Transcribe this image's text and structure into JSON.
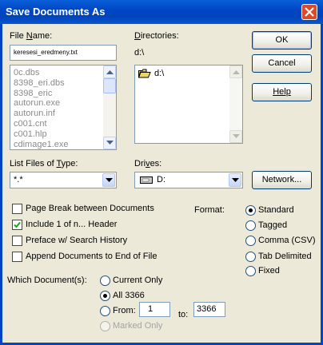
{
  "window": {
    "title": "Save Documents As"
  },
  "file_name": {
    "label_pre": "File ",
    "label_key": "N",
    "label_post": "ame:",
    "value": "keresesi_eredmeny.txt"
  },
  "file_list": [
    "0c.dbs",
    "8398_eri.dbs",
    "8398_eric",
    "autorun.exe",
    "autorun.inf",
    "c001.cnt",
    "c001.hlp",
    "cdimage1.exe"
  ],
  "directories": {
    "label_key": "D",
    "label_post": "irectories:",
    "current_path": "d:\\",
    "items": [
      "d:\\"
    ]
  },
  "list_type": {
    "label_pre": "List Files of ",
    "label_key": "T",
    "label_post": "ype:",
    "value": "*.*"
  },
  "drives": {
    "label_pre": "Dri",
    "label_key": "v",
    "label_post": "es:",
    "value": "D:"
  },
  "buttons": {
    "ok": "OK",
    "cancel": "Cancel",
    "help": "Help",
    "network": "Network..."
  },
  "options": [
    {
      "label": "Page Break between Documents",
      "checked": false
    },
    {
      "label": "Include 1 of n... Header",
      "checked": true
    },
    {
      "label": "Preface w/ Search History",
      "checked": false
    },
    {
      "label": "Append Documents to End of File",
      "checked": false
    }
  ],
  "format": {
    "label": "Format:",
    "options": [
      "Standard",
      "Tagged",
      "Comma (CSV)",
      "Tab Delimited",
      "Fixed"
    ],
    "selected": "Standard"
  },
  "which_documents": {
    "label": "Which Document(s):",
    "current_only": "Current Only",
    "all": "All 3366",
    "from_label": "From:",
    "from_value": "1",
    "to_label": "to:",
    "to_value": "3366",
    "marked_only": "Marked Only",
    "selected": "All 3366"
  }
}
